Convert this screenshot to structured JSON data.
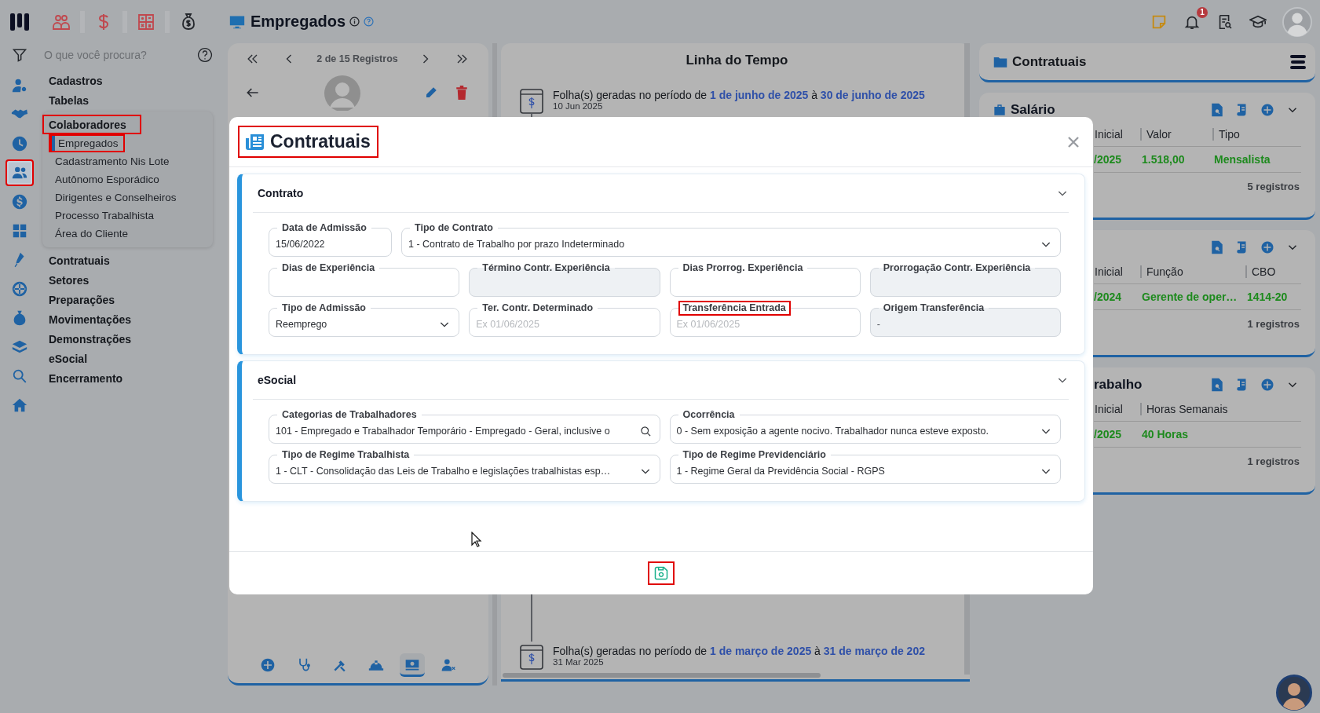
{
  "app": {
    "title": "Empregados"
  },
  "notifications": {
    "badge": "1"
  },
  "icon_rail": [
    {
      "selected": false,
      "highlighted": false
    },
    {
      "selected": false,
      "highlighted": false
    },
    {
      "selected": false,
      "highlighted": false
    },
    {
      "selected": true,
      "highlighted": true
    },
    {
      "selected": false,
      "highlighted": false
    },
    {
      "selected": false,
      "highlighted": false
    },
    {
      "selected": false,
      "highlighted": false
    },
    {
      "selected": false,
      "highlighted": false
    },
    {
      "selected": false,
      "highlighted": false
    },
    {
      "selected": false,
      "highlighted": false
    },
    {
      "selected": false,
      "highlighted": false
    },
    {
      "selected": false,
      "highlighted": false
    }
  ],
  "search": {
    "placeholder": "O que você procura?"
  },
  "menu": [
    {
      "label": "Cadastros",
      "expanded": false,
      "highlighted": false
    },
    {
      "label": "Tabelas",
      "expanded": false,
      "highlighted": false
    },
    {
      "label": "Colaboradores",
      "expanded": true,
      "highlighted": true,
      "children": [
        {
          "label": "Empregados",
          "selected": true,
          "highlighted": true
        },
        {
          "label": "Cadastramento Nis Lote",
          "selected": false,
          "highlighted": false
        },
        {
          "label": "Autônomo Esporádico",
          "selected": false,
          "highlighted": false
        },
        {
          "label": "Dirigentes e Conselheiros",
          "selected": false,
          "highlighted": false
        },
        {
          "label": "Processo Trabalhista",
          "selected": false,
          "highlighted": false
        },
        {
          "label": "Área do Cliente",
          "selected": false,
          "highlighted": false
        }
      ]
    },
    {
      "label": "Contratuais",
      "expanded": false,
      "highlighted": false
    },
    {
      "label": "Setores",
      "expanded": false,
      "highlighted": false
    },
    {
      "label": "Preparações",
      "expanded": false,
      "highlighted": false
    },
    {
      "label": "Movimentações",
      "expanded": false,
      "highlighted": false
    },
    {
      "label": "Demonstrações",
      "expanded": false,
      "highlighted": false
    },
    {
      "label": "eSocial",
      "expanded": false,
      "highlighted": false
    },
    {
      "label": "Encerramento",
      "expanded": false,
      "highlighted": false
    }
  ],
  "record_nav": {
    "label": "2 de 15 Registros"
  },
  "record_tabs": [
    {
      "selected": false
    },
    {
      "selected": false
    },
    {
      "selected": false
    },
    {
      "selected": false
    },
    {
      "selected": true
    },
    {
      "selected": false
    }
  ],
  "timeline": {
    "title": "Linha do Tempo",
    "items": [
      {
        "text": "Folha(s) geradas no período de **1 de junho de 2025** à **30 de junho de 2025**",
        "date": "10 Jun 2025"
      },
      {
        "text": "Folha(s) geradas no período de **1 de março de 2025** à **31 de março de 202**",
        "date": "31 Mar 2025"
      }
    ]
  },
  "contract_panel": {
    "title": "Contratuais",
    "cards": [
      {
        "title": "Salário",
        "columns": [
          "Inicial",
          "Valor",
          "Tipo"
        ],
        "rows": [
          [
            "/2025",
            "1.518,00",
            "Mensalista"
          ]
        ],
        "count": "5 registros"
      },
      {
        "columns": [
          "Inicial",
          "Função",
          "CBO"
        ],
        "rows": [
          [
            "/2024",
            "Gerente de oper…",
            "1414-20"
          ]
        ],
        "count": "1 registros"
      },
      {
        "title": "rabalho",
        "columns": [
          "Inicial",
          "Horas Semanais"
        ],
        "rows": [
          [
            "/2025",
            "40 Horas"
          ]
        ],
        "count": "1 registros"
      }
    ]
  },
  "modal": {
    "title": "Contratuais",
    "highlighted": true,
    "save_highlighted": true,
    "sections": [
      {
        "title": "Contrato",
        "expanded": true,
        "rows": [
          [
            {
              "label": "Data de Admissão",
              "value": "15/06/2022",
              "kind": "text",
              "disabled": false,
              "highlighted": false
            },
            {
              "label": "Tipo de Contrato",
              "value": "1 - Contrato de Trabalho por prazo Indeterminado",
              "kind": "select",
              "disabled": false,
              "highlighted": false
            }
          ],
          [
            {
              "label": "Dias de Experiência",
              "kind": "text",
              "disabled": false,
              "highlighted": false
            },
            {
              "label": "Término Contr. Experiência",
              "kind": "text",
              "disabled": true,
              "highlighted": false
            },
            {
              "label": "Dias Prorrog. Experiência",
              "kind": "text",
              "disabled": false,
              "highlighted": false
            },
            {
              "label": "Prorrogação Contr. Experiência",
              "kind": "text",
              "disabled": true,
              "highlighted": false
            }
          ],
          [
            {
              "label": "Tipo de Admissão",
              "value": "Reemprego",
              "kind": "select",
              "disabled": false,
              "highlighted": false
            },
            {
              "label": "Ter. Contr. Determinado",
              "placeholder": "Ex 01/06/2025",
              "kind": "text",
              "disabled": false,
              "highlighted": false
            },
            {
              "label": "Transferência Entrada",
              "placeholder": "Ex 01/06/2025",
              "kind": "text",
              "disabled": false,
              "highlighted": true
            },
            {
              "label": "Origem Transferência",
              "value": "-",
              "kind": "text",
              "disabled": true,
              "highlighted": false
            }
          ]
        ]
      },
      {
        "title": "eSocial",
        "expanded": true,
        "rows": [
          [
            {
              "label": "Categorias de Trabalhadores",
              "value": "101 - Empregado e Trabalhador Temporário - Empregado - Geral, inclusive o",
              "kind": "search",
              "disabled": false,
              "highlighted": false
            },
            {
              "label": "Ocorrência",
              "value": "0 - Sem exposição a agente nocivo. Trabalhador nunca esteve exposto.",
              "kind": "select",
              "disabled": false,
              "highlighted": false
            }
          ],
          [
            {
              "label": "Tipo de Regime Trabalhista",
              "value": "1 - CLT - Consolidação das Leis de Trabalho e legislações trabalhistas esp…",
              "kind": "select",
              "disabled": false,
              "highlighted": false
            },
            {
              "label": "Tipo de Regime Previdenciário",
              "value": "1 - Regime Geral da Previdência Social - RGPS",
              "kind": "select",
              "disabled": false,
              "highlighted": false
            }
          ]
        ]
      }
    ]
  }
}
